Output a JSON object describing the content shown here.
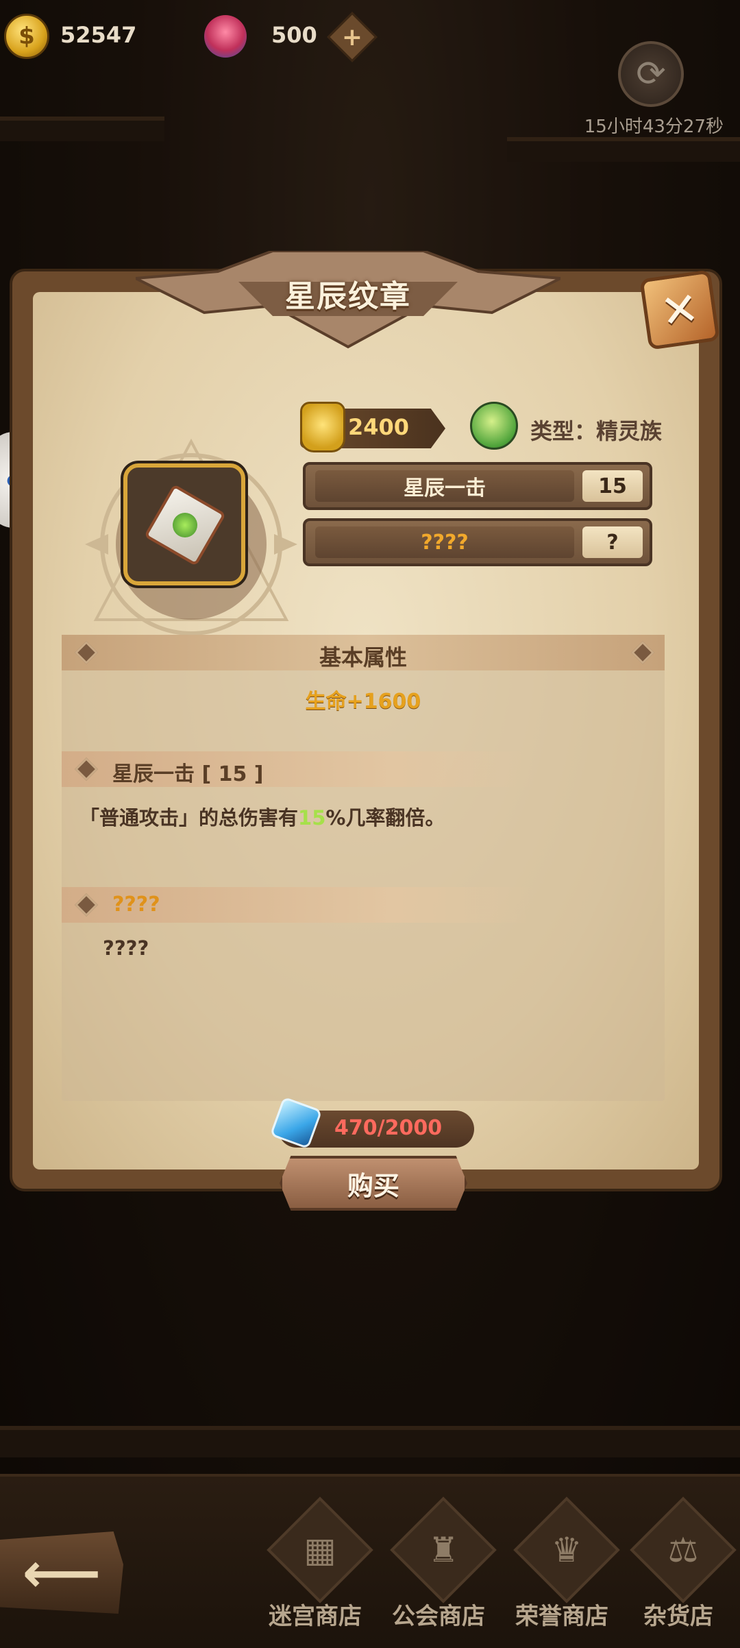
{
  "topbar": {
    "gold_amount": "52547",
    "gem_amount": "500",
    "add_icon": "plus-icon",
    "refresh_icon": "refresh-icon",
    "timer": "15小时43分27秒"
  },
  "popup": {
    "title": "星辰纹章",
    "close_icon": "close-icon",
    "power": "2400",
    "type_label": "类型：精灵族",
    "skills": [
      {
        "name": "星辰一击",
        "level": "15",
        "name_color": "#fbeed4"
      },
      {
        "name": "????",
        "level": "?",
        "name_color": "#f2a92c"
      }
    ],
    "basic_header": "基本属性",
    "basic_stat": "生命+1600",
    "skill_detail_1": {
      "header": "星辰一击 [ 15 ]",
      "desc_prefix": "「普通攻击」的总伤害有",
      "desc_highlight": "15",
      "desc_suffix": "%几率翻倍。"
    },
    "skill_detail_2": {
      "header": "????",
      "desc": "????"
    },
    "cost": "470/2000",
    "buy_label": "购买"
  },
  "nav": {
    "back_icon": "back-arrow-icon",
    "items": [
      {
        "label": "迷宫商店",
        "icon": "maze-icon"
      },
      {
        "label": "公会商店",
        "icon": "guild-icon"
      },
      {
        "label": "荣誉商店",
        "icon": "honor-chest-icon"
      },
      {
        "label": "杂货店",
        "icon": "scales-icon"
      }
    ]
  }
}
